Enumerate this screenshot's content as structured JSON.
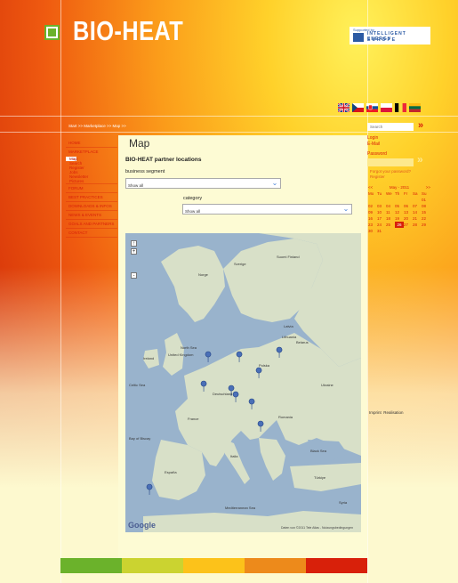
{
  "header": {
    "logo_text": "BIO-HEAT",
    "partner_logo": {
      "small": "Supported by",
      "line1": "INTELLIGENT ENERGY",
      "line2": "EUROPE"
    },
    "languages": [
      {
        "code": "en",
        "colors": [
          "#1f3f8a",
          "#cf1020",
          "#ffffff"
        ]
      },
      {
        "code": "cz",
        "colors": [
          "#ffffff",
          "#d7141a",
          "#11457e"
        ]
      },
      {
        "code": "sk",
        "colors": [
          "#ffffff",
          "#0b4ea2",
          "#ee1c25"
        ]
      },
      {
        "code": "pl",
        "colors": [
          "#ffffff",
          "#dc143c"
        ]
      },
      {
        "code": "be",
        "colors": [
          "#000000",
          "#fae042",
          "#ed2939"
        ]
      },
      {
        "code": "lt",
        "colors": [
          "#fdb913",
          "#006a44",
          "#c1272d"
        ]
      }
    ]
  },
  "breadcrumb": "Start >> Marketplace >> Map >>",
  "search": {
    "placeholder": "Search",
    "go_icon": "»"
  },
  "nav": {
    "items": [
      {
        "label": "HOME"
      },
      {
        "label": "MARKETPLACE",
        "children": [
          "Map",
          "Search",
          "Register",
          "Jobs",
          "Newsletter",
          "Pictures"
        ]
      },
      {
        "label": "FORUM"
      },
      {
        "label": "BEST PRACTICES"
      },
      {
        "label": "DOWNLOADS & INFOS"
      },
      {
        "label": "NEWS & EVENTS"
      },
      {
        "label": "GOALS AND PARTNERS"
      },
      {
        "label": "CONTACT"
      }
    ]
  },
  "main": {
    "title": "Map",
    "subtitle": "BIO-HEAT partner locations",
    "filter1": {
      "label": "business segment",
      "value": "Show all"
    },
    "filter2": {
      "label": "category",
      "value": "Show all"
    },
    "map": {
      "zoom": [
        "+",
        "-"
      ],
      "attribution": "Google",
      "copyright": "Daten von ©2011 Tele Atlas - Nutzungsbedingungen",
      "countries": [
        "Norge",
        "Sverige",
        "Suomi Finland",
        "Latvia",
        "Polska",
        "Deutschland",
        "France",
        "España",
        "Italia",
        "Romania",
        "Ukraine",
        "Türkiye",
        "Belarus",
        "Lithuania",
        "United Kingdom",
        "Ireland",
        "Black Sea",
        "North Sea",
        "Celtic Sea",
        "Bay of Biscay",
        "Mediterranean Sea",
        "Syria"
      ],
      "markers": 10
    }
  },
  "right": {
    "login_label": "Login",
    "email_label": "E-Mail",
    "password_label": "Password",
    "go_icon": "»",
    "forgot": "Forgot your password?",
    "register": "Register",
    "calendar": {
      "prev": "<<",
      "month": "May - 2011",
      "next": ">>",
      "days": [
        "Mo",
        "Tu",
        "We",
        "Th",
        "Fr",
        "Sa",
        "Su"
      ],
      "dates": [
        "",
        "",
        "",
        "",
        "",
        "",
        "01",
        "02",
        "03",
        "04",
        "05",
        "06",
        "07",
        "08",
        "09",
        "10",
        "11",
        "12",
        "13",
        "14",
        "15",
        "16",
        "17",
        "18",
        "19",
        "20",
        "21",
        "22",
        "23",
        "24",
        "25",
        "26",
        "27",
        "28",
        "29",
        "30",
        "31"
      ],
      "today": "26"
    },
    "imprint": "Imprint",
    "realisation": "Realisation"
  },
  "footer": {
    "colors": [
      "#6bb22b",
      "#cbd330",
      "#fcc21a",
      "#ed8a1b",
      "#d8200a"
    ]
  }
}
